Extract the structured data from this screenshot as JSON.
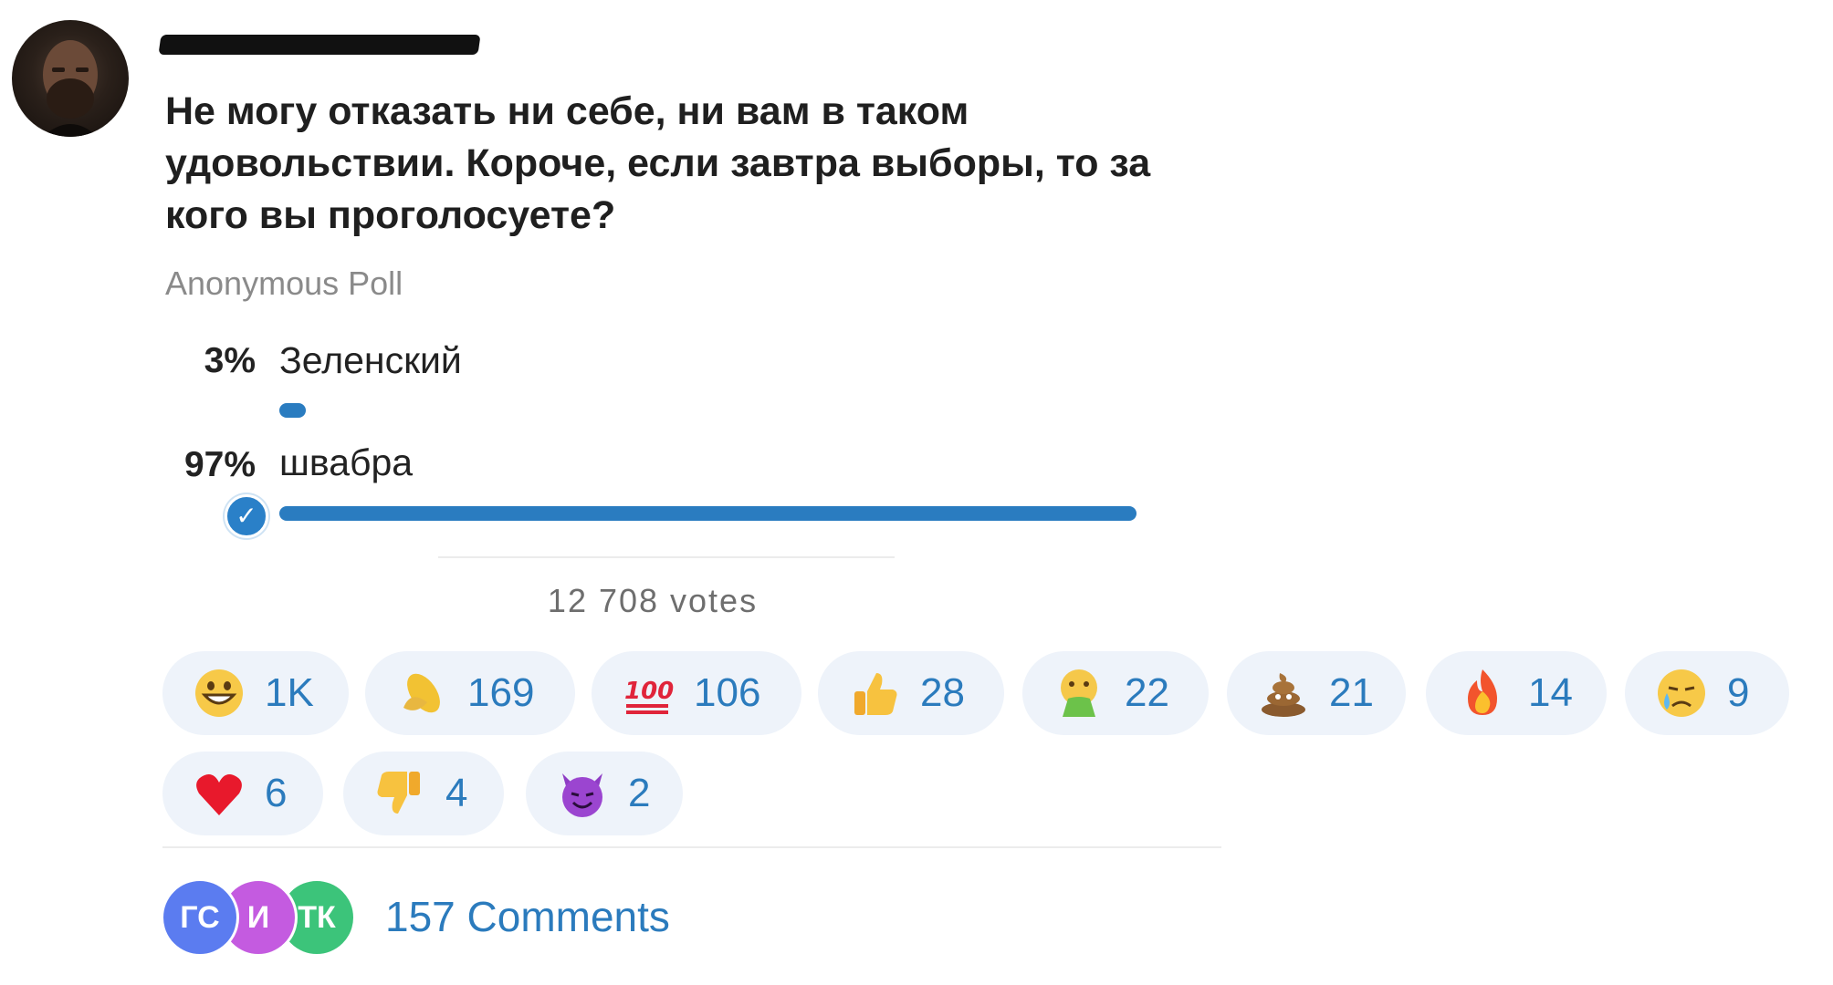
{
  "post": {
    "author": "",
    "text": "Не могу отказать ни себе, ни вам в таком удовольствии. Короче, если завтра выборы, то за кого вы проголосуете?"
  },
  "poll": {
    "type": "Anonymous Poll",
    "options": [
      {
        "percent_label": "3%",
        "label": "Зеленский",
        "fraction": 0.03,
        "selected": false
      },
      {
        "percent_label": "97%",
        "label": "швабра",
        "fraction": 0.97,
        "selected": true
      }
    ],
    "votes": "12 708 votes"
  },
  "reactions": [
    {
      "icon": "grinning-face-icon",
      "count": "1K"
    },
    {
      "icon": "corn-icon",
      "count": "169"
    },
    {
      "icon": "hundred-points-icon",
      "count": "106"
    },
    {
      "icon": "thumbs-up-icon",
      "count": "28"
    },
    {
      "icon": "nauseated-face-icon",
      "count": "22"
    },
    {
      "icon": "poop-icon",
      "count": "21"
    },
    {
      "icon": "fire-icon",
      "count": "14"
    },
    {
      "icon": "crying-face-icon",
      "count": "9"
    },
    {
      "icon": "red-heart-icon",
      "count": "6"
    },
    {
      "icon": "thumbs-down-icon",
      "count": "4"
    },
    {
      "icon": "smiling-devil-icon",
      "count": "2"
    }
  ],
  "comments": {
    "avatars": [
      {
        "initials": "ГС",
        "color": "#5b7cf0"
      },
      {
        "initials": "И",
        "color": "#c45be0"
      },
      {
        "initials": "ТК",
        "color": "#3cc47a"
      }
    ],
    "label": "157 Comments"
  },
  "colors": {
    "accent": "#2b7bbd",
    "bar": "#2a7cc0",
    "reaction_bg": "#eef3fa"
  }
}
